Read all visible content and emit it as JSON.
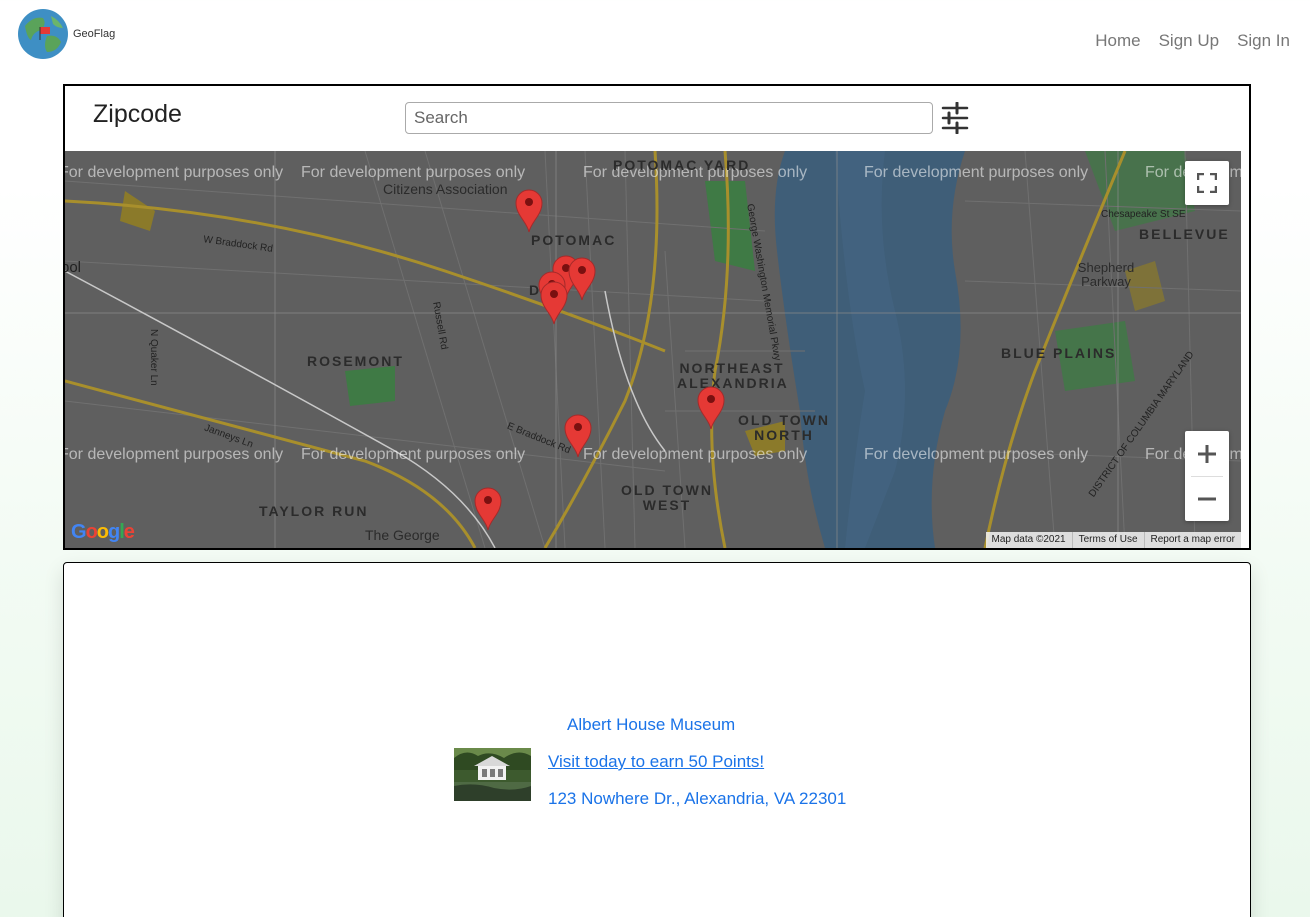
{
  "brand": {
    "name": "GeoFlag",
    "logo_icon": "globe-flag-icon"
  },
  "nav": {
    "items": [
      "Home",
      "Sign Up",
      "Sign In"
    ]
  },
  "search_panel": {
    "title": "Zipcode",
    "search_placeholder": "Search",
    "filter_icon": "sliders-icon"
  },
  "map": {
    "watermark": "For development purposes only",
    "area_labels": [
      "POTOMAC YARD",
      "POTOMAC",
      "DEL",
      "ROSEMONT",
      "NORTHEAST ALEXANDRIA",
      "OLD TOWN NORTH",
      "OLD TOWN WEST",
      "TAYLOR RUN",
      "BELLEVUE",
      "BLUE PLAINS",
      "Shepherd Parkway",
      "Citizens Association",
      "The George"
    ],
    "road_labels": [
      "W Braddock Rd",
      "Russell Rd",
      "N Quaker Ln",
      "Janneys Ln",
      "E Braddock Rd",
      "George Washington Memorial Pkwy",
      "Chesapeake St SE",
      "DISTRICT OF COLUMBIA MARYLAND",
      "bol"
    ],
    "attribution": [
      "Map data ©2021",
      "Terms of Use",
      "Report a map error"
    ],
    "google_logo": "Google",
    "controls": {
      "fullscreen_icon": "fullscreen-icon",
      "zoom_in_icon": "plus-icon",
      "zoom_out_icon": "minus-icon"
    },
    "marker_count": 7,
    "colors": {
      "water": "#3f5e78",
      "land": "#5f5f5f",
      "park": "#3f7a45",
      "marker": "#e53935"
    }
  },
  "place": {
    "name": "Albert House Museum",
    "cta": "Visit today to earn 50 Points!",
    "address": "123 Nowhere Dr., Alexandria, VA 22301"
  }
}
